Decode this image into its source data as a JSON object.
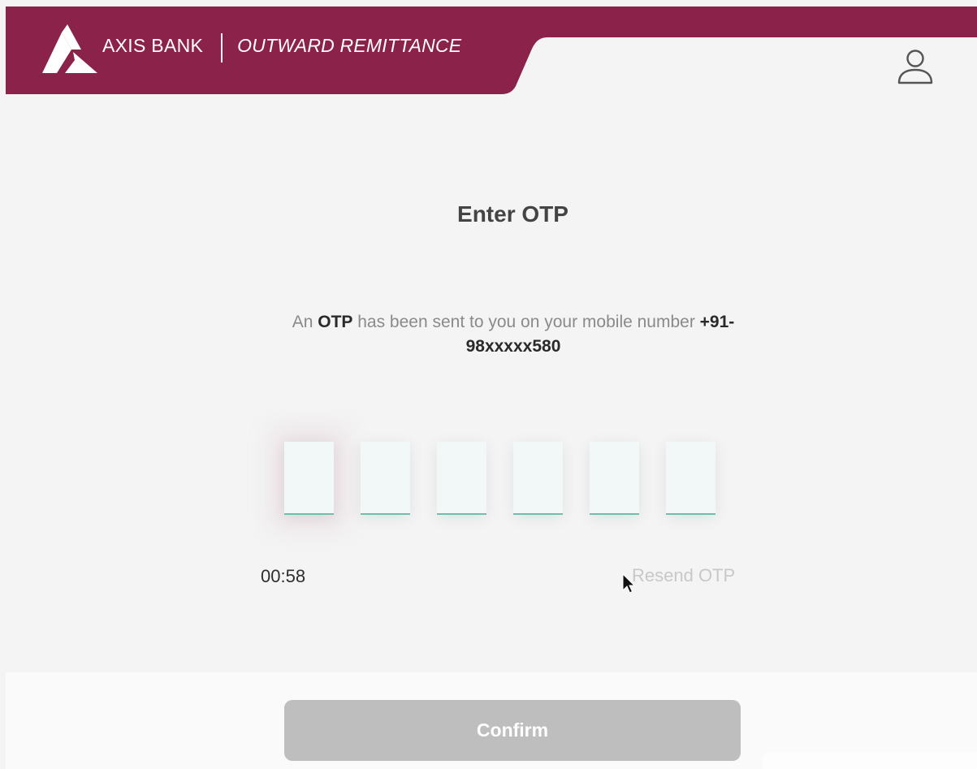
{
  "header": {
    "bank_name": "AXIS BANK",
    "product_name": "OUTWARD REMITTANCE",
    "logo_icon": "axis-bank-logo",
    "profile_icon": "user-profile-icon"
  },
  "otp": {
    "title": "Enter OTP",
    "message_prefix": "An ",
    "message_otp": "OTP",
    "message_middle": " has been sent to you on your mobile number ",
    "mobile_number": "+91-98xxxxx580",
    "digits": [
      "",
      "",
      "",
      "",
      "",
      ""
    ],
    "timer": "00:58",
    "resend_label": "Resend OTP"
  },
  "footer": {
    "confirm_label": "Confirm"
  },
  "colors": {
    "brand": "#8b2249",
    "input_underline": "#6dbfad",
    "button_disabled": "#bebebe",
    "background": "#f4f4f4"
  }
}
